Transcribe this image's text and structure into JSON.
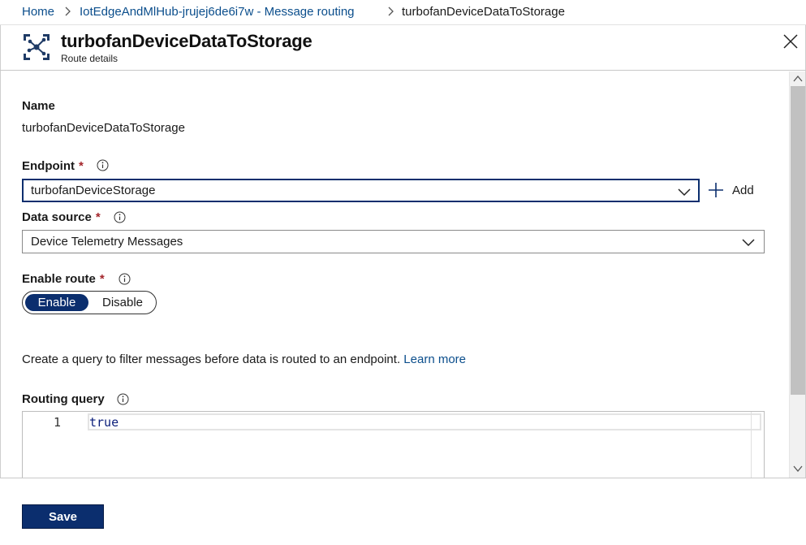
{
  "breadcrumb": {
    "items": [
      "Home",
      "IotEdgeAndMlHub-jrujej6de6i7w - Message routing",
      "turbofanDeviceDataToStorage"
    ]
  },
  "header": {
    "title": "turbofanDeviceDataToStorage",
    "subtitle": "Route details",
    "icon": "route-icon"
  },
  "form": {
    "name": {
      "label": "Name",
      "value": "turbofanDeviceDataToStorage"
    },
    "endpoint": {
      "label": "Endpoint",
      "required_mark": "*",
      "value": "turbofanDeviceStorage",
      "add_label": "Add"
    },
    "data_source": {
      "label": "Data source",
      "required_mark": "*",
      "value": "Device Telemetry Messages"
    },
    "enable_route": {
      "label": "Enable route",
      "required_mark": "*",
      "options": [
        "Enable",
        "Disable"
      ],
      "selected": "Enable"
    },
    "query_description": "Create a query to filter messages before data is routed to an endpoint.",
    "learn_more": "Learn more",
    "routing_query": {
      "label": "Routing query",
      "line_number": "1",
      "code": "true"
    }
  },
  "footer": {
    "save_label": "Save"
  },
  "colors": {
    "accent": "#0b2e6e",
    "link": "#0b4e8c",
    "required": "#a4262c"
  }
}
